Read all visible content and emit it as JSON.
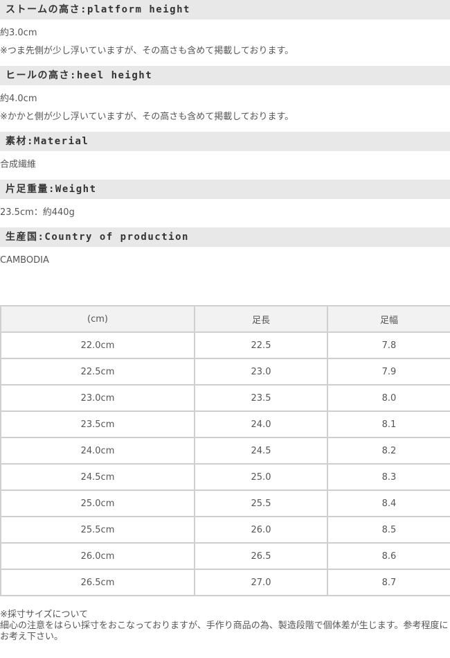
{
  "specs": [
    {
      "title": "ストームの高さ:platform height",
      "lines": [
        "約3.0cm",
        "※つま先側が少し浮いていますが、その高さも含めて掲載しております。"
      ]
    },
    {
      "title": "ヒールの高さ:heel height",
      "lines": [
        "約4.0cm",
        "※かかと側が少し浮いていますが、その高さも含めて掲載しております。"
      ]
    },
    {
      "title": "素材:Material",
      "lines": [
        "合成繊維"
      ]
    },
    {
      "title": "片足重量:Weight",
      "lines": [
        "23.5cm：約440g"
      ]
    },
    {
      "title": "生産国:Country of production",
      "lines": [
        "CAMBODIA"
      ]
    }
  ],
  "size_table": {
    "headers": [
      "(cm)",
      "足長",
      "足幅"
    ],
    "rows": [
      [
        "22.0cm",
        "22.5",
        "7.8"
      ],
      [
        "22.5cm",
        "23.0",
        "7.9"
      ],
      [
        "23.0cm",
        "23.5",
        "8.0"
      ],
      [
        "23.5cm",
        "24.0",
        "8.1"
      ],
      [
        "24.0cm",
        "24.5",
        "8.2"
      ],
      [
        "24.5cm",
        "25.0",
        "8.3"
      ],
      [
        "25.0cm",
        "25.5",
        "8.4"
      ],
      [
        "25.5cm",
        "26.0",
        "8.5"
      ],
      [
        "26.0cm",
        "26.5",
        "8.6"
      ],
      [
        "26.5cm",
        "27.0",
        "8.7"
      ]
    ]
  },
  "note": {
    "line1": "※採寸サイズについて",
    "line2": "細心の注意をはらい採寸をおこなっておりますが、手作り商品の為、製造段階で個体差が生じます。参考程度にお考え下さい。"
  }
}
